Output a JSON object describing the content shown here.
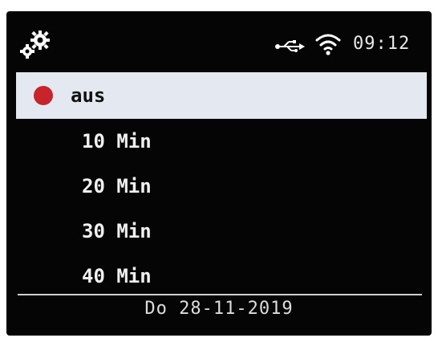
{
  "status_bar": {
    "settings_icon": "gear-pair-icon",
    "usb_icon": "usb-icon",
    "wifi_icon": "wifi-icon",
    "time": "09:12"
  },
  "menu": {
    "items": [
      {
        "label": "aus",
        "selected": true,
        "indicator": "record-dot"
      },
      {
        "label": "10 Min",
        "selected": false
      },
      {
        "label": "20 Min",
        "selected": false
      },
      {
        "label": "30 Min",
        "selected": false
      },
      {
        "label": "40 Min",
        "selected": false
      }
    ]
  },
  "footer": {
    "date": "Do 28-11-2019"
  },
  "colors": {
    "background": "#050505",
    "selection": "#e4e8f0",
    "indicator": "#c8242c",
    "text": "#f0f0f0"
  }
}
